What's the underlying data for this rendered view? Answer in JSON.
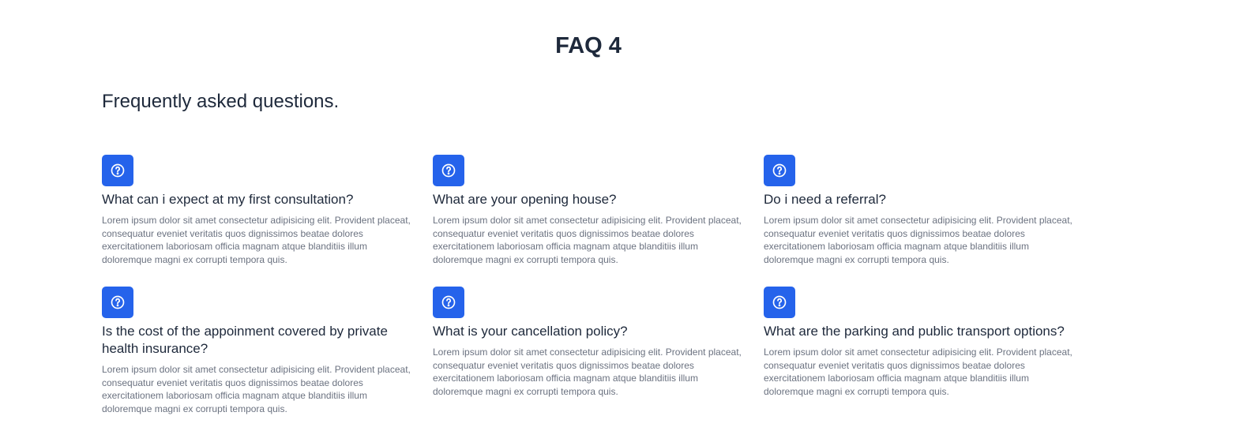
{
  "page_title": "FAQ 4",
  "section_heading": "Frequently asked questions.",
  "colors": {
    "accent": "#2563eb",
    "heading": "#1e293b",
    "body_text": "#6b7280"
  },
  "faqs": [
    {
      "icon": "question-circle-icon",
      "question": "What can i expect at my first consultation?",
      "answer": "Lorem ipsum dolor sit amet consectetur adipisicing elit. Provident placeat, consequatur eveniet veritatis quos dignissimos beatae dolores exercitationem laboriosam officia magnam atque blanditiis illum doloremque magni ex corrupti tempora quis."
    },
    {
      "icon": "question-circle-icon",
      "question": "What are your opening house?",
      "answer": "Lorem ipsum dolor sit amet consectetur adipisicing elit. Provident placeat, consequatur eveniet veritatis quos dignissimos beatae dolores exercitationem laboriosam officia magnam atque blanditiis illum doloremque magni ex corrupti tempora quis."
    },
    {
      "icon": "question-circle-icon",
      "question": "Do i need a referral?",
      "answer": "Lorem ipsum dolor sit amet consectetur adipisicing elit. Provident placeat, consequatur eveniet veritatis quos dignissimos beatae dolores exercitationem laboriosam officia magnam atque blanditiis illum doloremque magni ex corrupti tempora quis."
    },
    {
      "icon": "question-circle-icon",
      "question": "Is the cost of the appoinment covered by private health insurance?",
      "answer": "Lorem ipsum dolor sit amet consectetur adipisicing elit. Provident placeat, consequatur eveniet veritatis quos dignissimos beatae dolores exercitationem laboriosam officia magnam atque blanditiis illum doloremque magni ex corrupti tempora quis."
    },
    {
      "icon": "question-circle-icon",
      "question": "What is your cancellation policy?",
      "answer": "Lorem ipsum dolor sit amet consectetur adipisicing elit. Provident placeat, consequatur eveniet veritatis quos dignissimos beatae dolores exercitationem laboriosam officia magnam atque blanditiis illum doloremque magni ex corrupti tempora quis."
    },
    {
      "icon": "question-circle-icon",
      "question": "What are the parking and public transport options?",
      "answer": "Lorem ipsum dolor sit amet consectetur adipisicing elit. Provident placeat, consequatur eveniet veritatis quos dignissimos beatae dolores exercitationem laboriosam officia magnam atque blanditiis illum doloremque magni ex corrupti tempora quis."
    }
  ]
}
